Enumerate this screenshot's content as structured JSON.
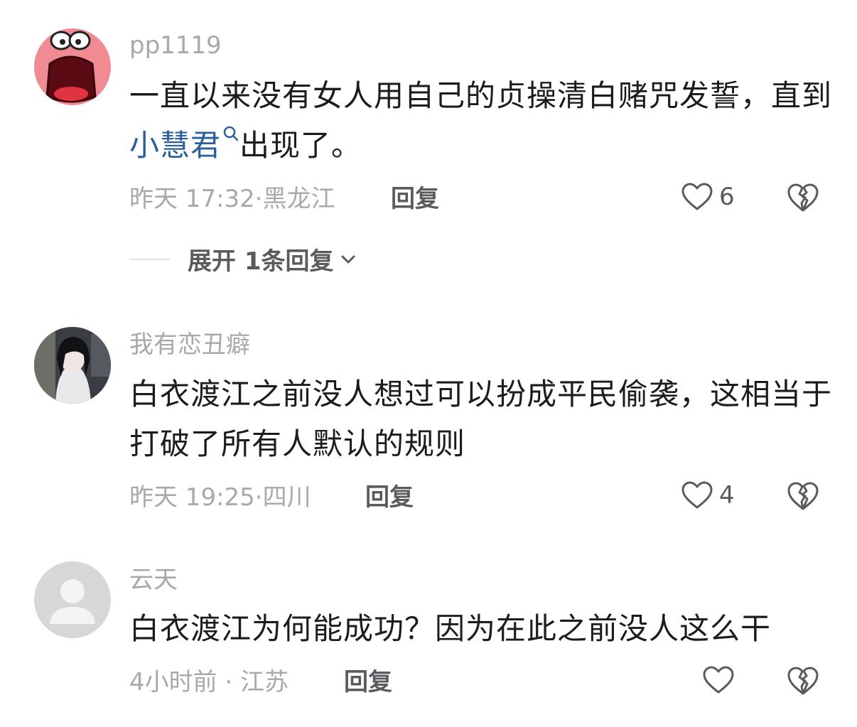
{
  "comments": [
    {
      "username": "pp1119",
      "text_before": "一直以来没有女人用自己的贞操清白赌咒发誓，直到",
      "mention": "小慧君",
      "text_after": "出现了。",
      "time": "昨天 17:32",
      "location": "黑龙江",
      "reply_label": "回复",
      "likes": "6",
      "expand_label": "展开 1条回复"
    },
    {
      "username": "我有恋丑癖",
      "text": "白衣渡江之前没人想过可以扮成平民偷袭，这相当于打破了所有人默认的规则",
      "time": "昨天 19:25",
      "location": "四川",
      "reply_label": "回复",
      "likes": "4"
    },
    {
      "username": "云天",
      "text": "白衣渡江为何能成功？因为在此之前没人这么干",
      "time": "4小时前",
      "location": "江苏",
      "reply_label": "回复",
      "likes": ""
    }
  ],
  "colors": {
    "mention": "#2a5f9e",
    "meta": "#a8a8ad",
    "text": "#1c1c1e"
  }
}
